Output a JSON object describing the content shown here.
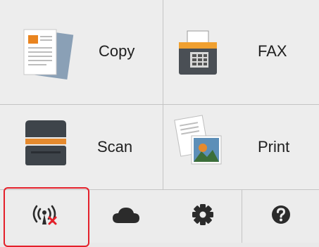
{
  "menu": {
    "copy_label": "Copy",
    "fax_label": "FAX",
    "scan_label": "Scan",
    "print_label": "Print"
  },
  "bottom_bar": {
    "items": [
      {
        "icon": "wireless-disconnected-icon",
        "selected": true
      },
      {
        "icon": "cloud-icon",
        "selected": false
      },
      {
        "icon": "gear-icon",
        "selected": false
      },
      {
        "icon": "help-icon",
        "selected": false
      }
    ]
  },
  "colors": {
    "background": "#ededed",
    "selection_border": "#e4202a",
    "icon_dark": "#2b2b2b",
    "fax_accent": "#f0a030",
    "scan_accent": "#e58a2e"
  }
}
